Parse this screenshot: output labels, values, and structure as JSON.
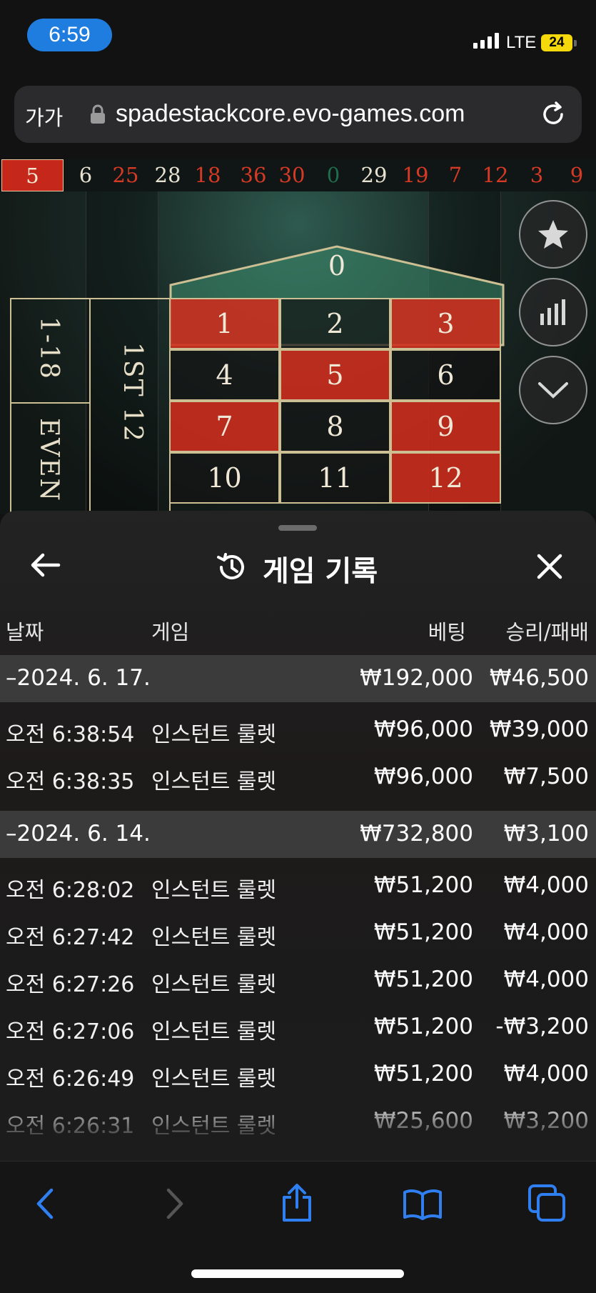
{
  "status_bar": {
    "time": "6:59",
    "network": "LTE",
    "battery": "24"
  },
  "browser": {
    "text_size_label": "가가",
    "url": "spadestackcore.evo-games.com"
  },
  "recent_numbers": [
    {
      "n": "5",
      "color": "red"
    },
    {
      "n": "6",
      "color": "white"
    },
    {
      "n": "25",
      "color": "red"
    },
    {
      "n": "28",
      "color": "white"
    },
    {
      "n": "18",
      "color": "red"
    },
    {
      "n": "36",
      "color": "red"
    },
    {
      "n": "30",
      "color": "red"
    },
    {
      "n": "0",
      "color": "green"
    },
    {
      "n": "29",
      "color": "white"
    },
    {
      "n": "19",
      "color": "red"
    },
    {
      "n": "7",
      "color": "red"
    },
    {
      "n": "12",
      "color": "red"
    },
    {
      "n": "3",
      "color": "red"
    },
    {
      "n": "9",
      "color": "red"
    }
  ],
  "roulette": {
    "zero": "0",
    "range_label": "1-18",
    "even_label": "EVEN",
    "dozen_label": "1ST 12",
    "numbers": [
      {
        "n": "1",
        "color": "red"
      },
      {
        "n": "2",
        "color": "black"
      },
      {
        "n": "3",
        "color": "red"
      },
      {
        "n": "4",
        "color": "black"
      },
      {
        "n": "5",
        "color": "red"
      },
      {
        "n": "6",
        "color": "black"
      },
      {
        "n": "7",
        "color": "red"
      },
      {
        "n": "8",
        "color": "black"
      },
      {
        "n": "9",
        "color": "red"
      },
      {
        "n": "10",
        "color": "black"
      },
      {
        "n": "11",
        "color": "black"
      },
      {
        "n": "12",
        "color": "red"
      }
    ]
  },
  "history": {
    "title": "게임 기록",
    "columns": {
      "date": "날짜",
      "game": "게임",
      "bet": "베팅",
      "result": "승리/패배"
    },
    "groups": [
      {
        "date": "–2024. 6. 17.",
        "bet": "₩192,000",
        "result": "₩46,500",
        "rows": [
          {
            "time": "오전 6:38:54",
            "game": "인스턴트 룰렛",
            "bet": "₩96,000",
            "result": "₩39,000"
          },
          {
            "time": "오전 6:38:35",
            "game": "인스턴트 룰렛",
            "bet": "₩96,000",
            "result": "₩7,500"
          }
        ]
      },
      {
        "date": "–2024. 6. 14.",
        "bet": "₩732,800",
        "result": "₩3,100",
        "rows": [
          {
            "time": "오전 6:28:02",
            "game": "인스턴트 룰렛",
            "bet": "₩51,200",
            "result": "₩4,000"
          },
          {
            "time": "오전 6:27:42",
            "game": "인스턴트 룰렛",
            "bet": "₩51,200",
            "result": "₩4,000"
          },
          {
            "time": "오전 6:27:26",
            "game": "인스턴트 룰렛",
            "bet": "₩51,200",
            "result": "₩4,000"
          },
          {
            "time": "오전 6:27:06",
            "game": "인스턴트 룰렛",
            "bet": "₩51,200",
            "result": "-₩3,200"
          },
          {
            "time": "오전 6:26:49",
            "game": "인스턴트 룰렛",
            "bet": "₩51,200",
            "result": "₩4,000"
          },
          {
            "time": "오전 6:26:31",
            "game": "인스턴트 룰렛",
            "bet": "₩25,600",
            "result": "₩3,200"
          }
        ]
      }
    ]
  },
  "colors": {
    "accent": "#1f7de0",
    "red": "#c8291b",
    "battery": "#f5d90a",
    "toolbar_icon": "#2f7ff0"
  }
}
